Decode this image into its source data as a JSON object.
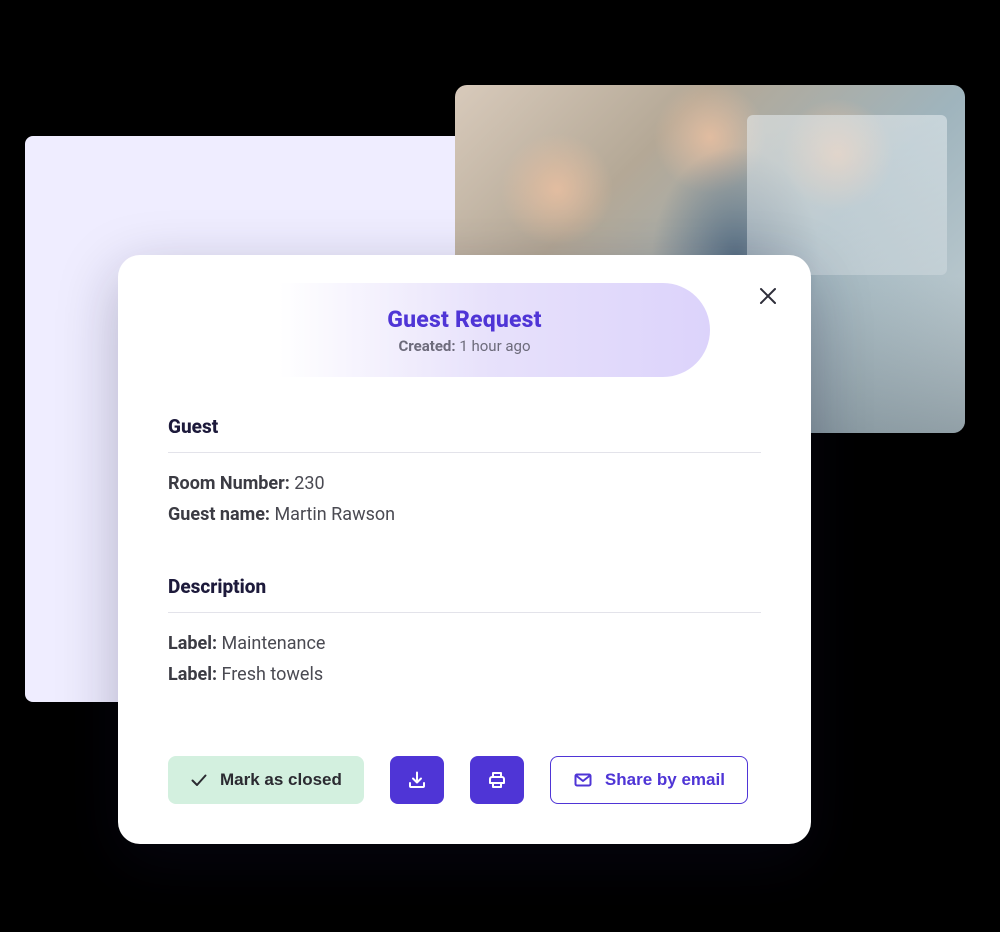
{
  "modal": {
    "title": "Guest Request",
    "created_label": "Created:",
    "created_value": "1 hour ago",
    "sections": {
      "guest": {
        "title": "Guest",
        "room_label": "Room Number:",
        "room_value": "230",
        "name_label": "Guest name:",
        "name_value": "Martin Rawson"
      },
      "description": {
        "title": "Description",
        "items": [
          {
            "label": "Label:",
            "value": "Maintenance"
          },
          {
            "label": "Label:",
            "value": "Fresh towels"
          }
        ]
      }
    },
    "actions": {
      "mark_closed": "Mark as closed",
      "share_email": "Share by email"
    }
  }
}
